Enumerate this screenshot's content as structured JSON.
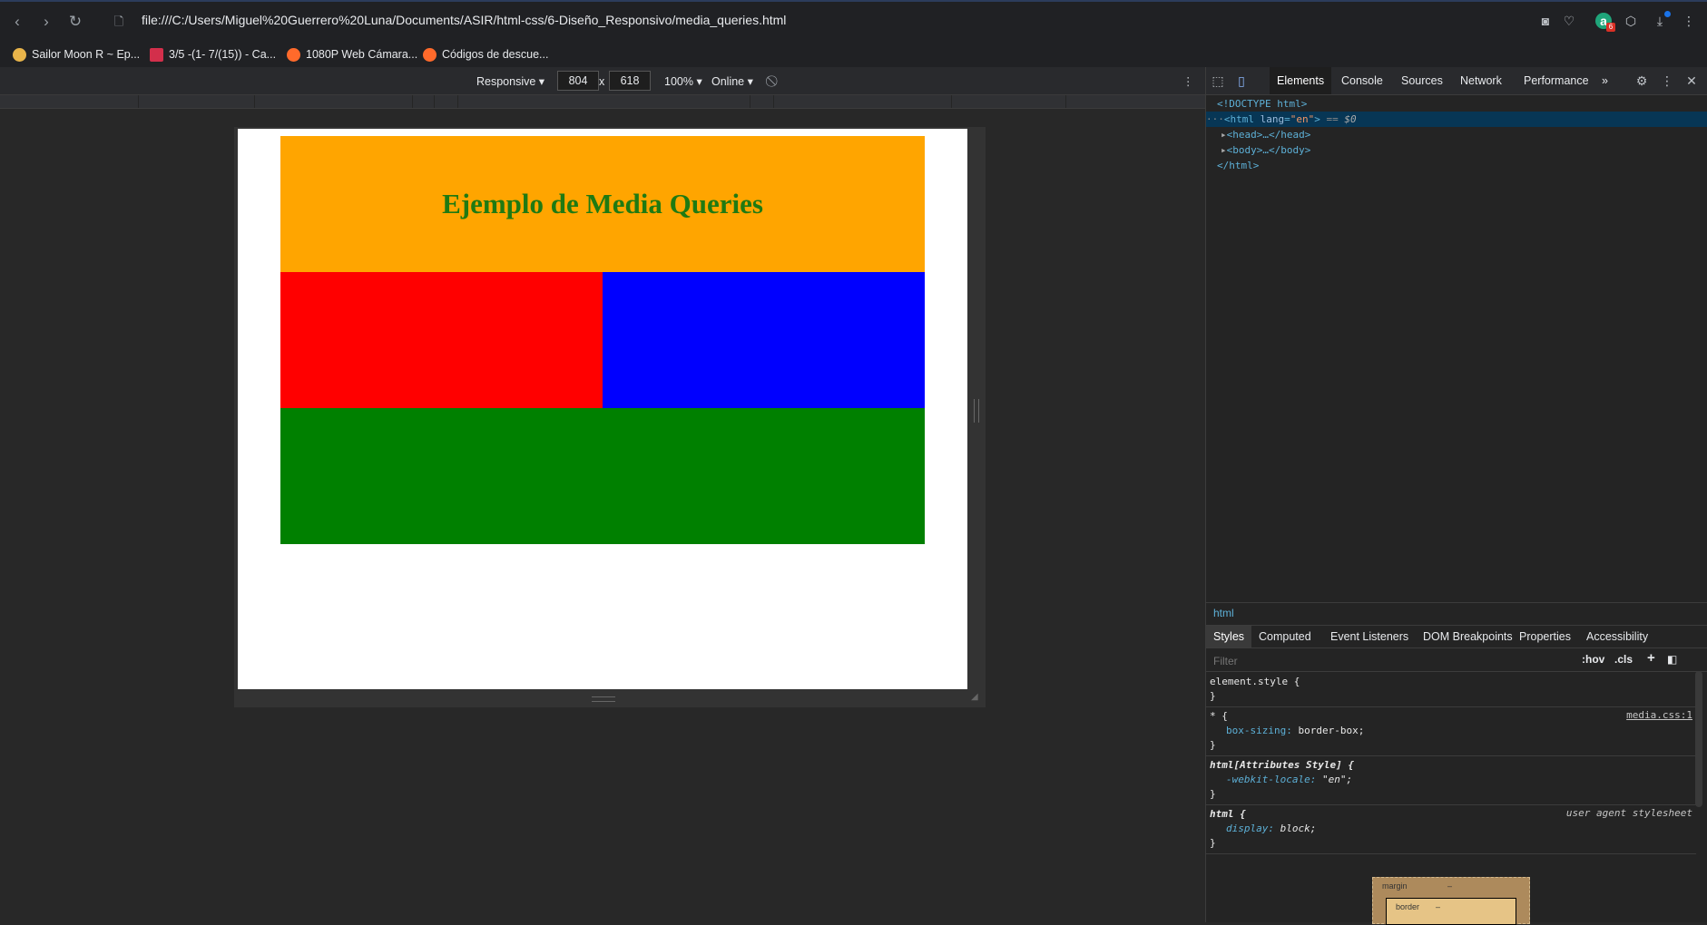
{
  "browser": {
    "url": "file:///C:/Users/Miguel%20Guerrero%20Luna/Documents/ASIR/html-css/6-Diseño_Responsivo/media_queries.html",
    "bookmarks": [
      {
        "label": "Sailor Moon R ~ Ep...",
        "icon": "crescent-moon-icon",
        "color": "#e8b44a"
      },
      {
        "label": "3/5 -(1- 7/(15)) - Ca...",
        "icon": "symbolab-icon",
        "color": "#d32f4b"
      },
      {
        "label": "1080P Web Cámara...",
        "icon": "flame-icon",
        "color": "#ff6a2b"
      },
      {
        "label": "Códigos de descue...",
        "icon": "flame-icon",
        "color": "#ff6a2b"
      }
    ],
    "badge": "6"
  },
  "device_toolbar": {
    "mode": "Responsive",
    "width": "804",
    "times": "x",
    "height": "618",
    "zoom": "100%",
    "network": "Online"
  },
  "page": {
    "heading": "Ejemplo de Media Queries",
    "colors": {
      "header": "#ffa500",
      "heading_text": "#1f7a12",
      "box1": "#ff0000",
      "box2": "#0000ff",
      "box3": "#008000"
    }
  },
  "devtools": {
    "tabs": [
      "Elements",
      "Console",
      "Sources",
      "Network",
      "Performance"
    ],
    "more": "»",
    "dom": [
      "<!DOCTYPE html>",
      "<html lang=\"en\"> == $0",
      "<head>…</head>",
      "<body>…</body>",
      "</html>"
    ],
    "breadcrumb": "html",
    "style_tabs": [
      "Styles",
      "Computed",
      "Event Listeners",
      "DOM Breakpoints",
      "Properties",
      "Accessibility"
    ],
    "filter_placeholder": "Filter",
    "hov": ":hov",
    "cls": ".cls",
    "rules": [
      {
        "selector": "element.style {",
        "source": "",
        "props": [],
        "close": "}"
      },
      {
        "selector": "* {",
        "source": "media.css:1",
        "props": [
          {
            "name": "box-sizing",
            "value": "border-box;"
          }
        ],
        "close": "}"
      },
      {
        "selector": "html[Attributes Style] {",
        "source": "",
        "props": [
          {
            "name": "-webkit-locale",
            "value": "\"en\";"
          }
        ],
        "close": "}"
      },
      {
        "selector": "html {",
        "source": "user agent stylesheet",
        "props": [
          {
            "name": "display",
            "value": "block;"
          }
        ],
        "close": "}"
      }
    ],
    "boxmodel": {
      "margin_label": "margin",
      "margin_value": "–",
      "border_label": "border",
      "border_value": "–"
    }
  }
}
